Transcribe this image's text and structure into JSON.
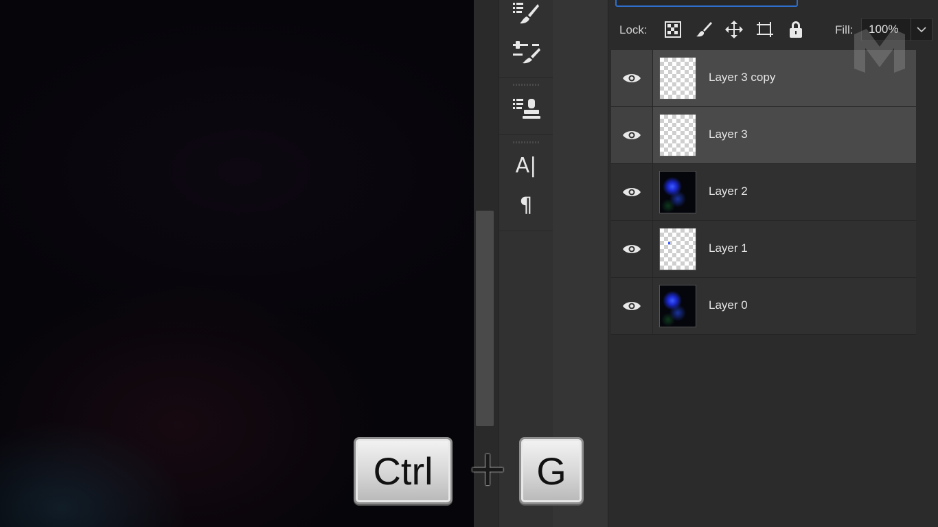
{
  "lock": {
    "label": "Lock:",
    "icons": [
      "transparency-lock-icon",
      "brush-lock-icon",
      "move-lock-icon",
      "artboard-lock-icon",
      "lock-all-icon"
    ]
  },
  "fill": {
    "label": "Fill:",
    "value": "100%"
  },
  "layers": [
    {
      "name": "Layer 3 copy",
      "thumb": "transparent",
      "selected": true
    },
    {
      "name": "Layer 3",
      "thumb": "transparent",
      "selected": true
    },
    {
      "name": "Layer 2",
      "thumb": "image",
      "selected": false
    },
    {
      "name": "Layer 1",
      "thumb": "transparent",
      "selected": false
    },
    {
      "name": "Layer 0",
      "thumb": "image",
      "selected": false
    }
  ],
  "strip": {
    "icons": [
      "brush-settings-icon",
      "brush-presets-icon",
      "clone-source-icon",
      "character-icon",
      "paragraph-icon"
    ],
    "character_glyph": "A|",
    "paragraph_glyph": "¶"
  },
  "shortcut": {
    "key1": "Ctrl",
    "plus": "+",
    "key2": "G"
  },
  "colors": {
    "selection_blue": "#2f6fcc",
    "panel_bg": "#2b2b2b"
  }
}
